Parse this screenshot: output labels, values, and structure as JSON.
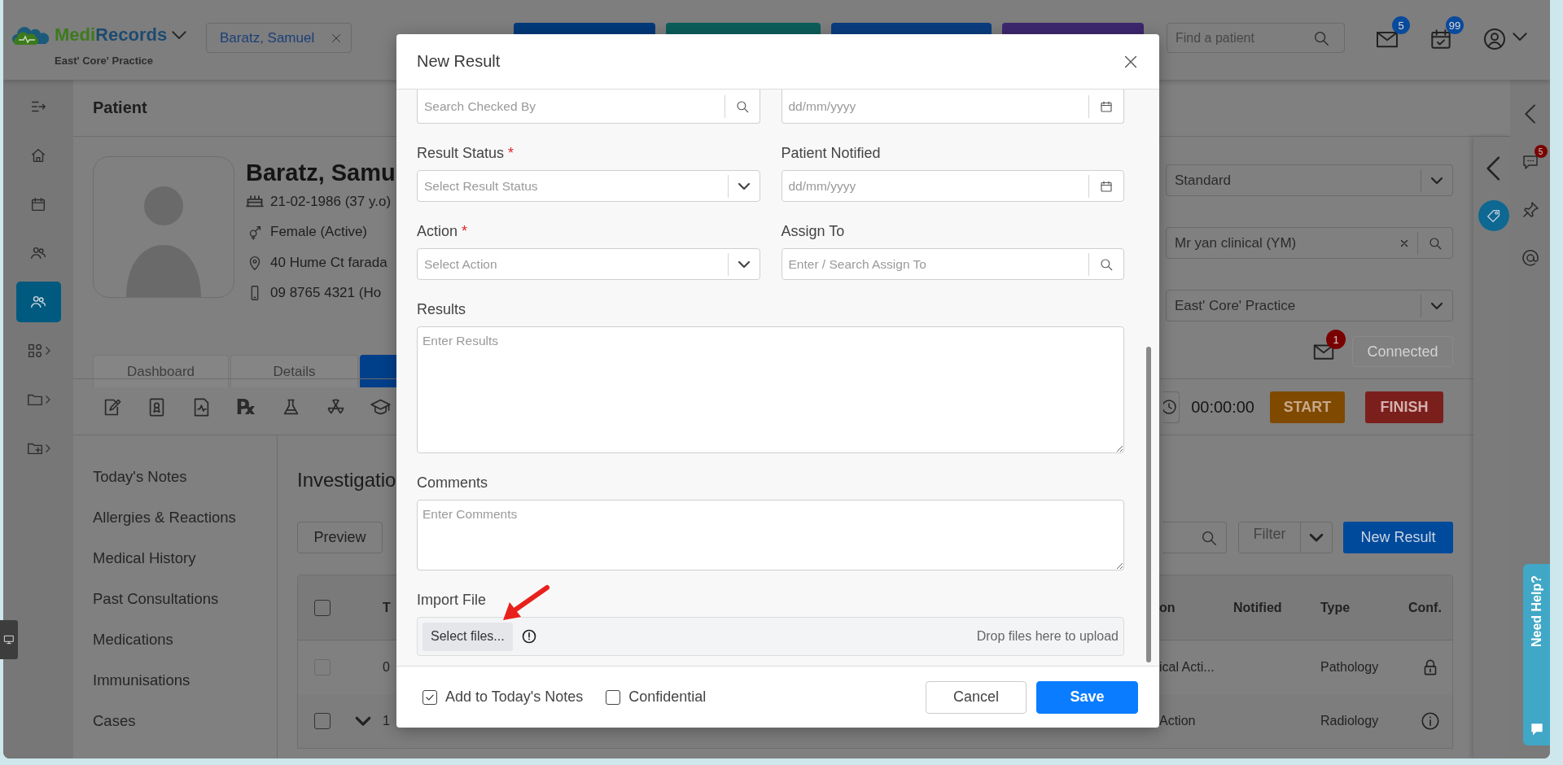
{
  "header": {
    "brand": "MediRecords",
    "practice": "East' Core' Practice",
    "patient_chip": "Baratz, Samuel",
    "quick_buttons": [
      {
        "color": "#00397a"
      },
      {
        "color": "#0b5e5b"
      },
      {
        "color": "#0a3d7f"
      },
      {
        "color": "#3d276e"
      }
    ],
    "search": {
      "placeholder": "Find a patient"
    },
    "notifications": [
      {
        "kind": "mail",
        "count": "5"
      },
      {
        "kind": "tasks",
        "count": "99"
      }
    ]
  },
  "rail": [
    {
      "selected": false,
      "submenu": false
    },
    {
      "selected": false,
      "submenu": false
    },
    {
      "selected": false,
      "submenu": false
    },
    {
      "selected": false,
      "submenu": false
    },
    {
      "selected": true,
      "submenu": false
    },
    {
      "selected": false,
      "submenu": true
    },
    {
      "selected": false,
      "submenu": true
    },
    {
      "selected": false,
      "submenu": true
    }
  ],
  "page_title": "Patient",
  "patient": {
    "name": "Baratz, Samu",
    "details": [
      {
        "kind": "birth",
        "text": "21-02-1986 (37 y.o)"
      },
      {
        "kind": "gender",
        "text": "Female (Active)"
      },
      {
        "kind": "address",
        "text": "40 Hume Ct farada"
      },
      {
        "kind": "phone",
        "text": "09 8765 4321 (Ho"
      }
    ]
  },
  "patient_settings": [
    {
      "kind": "select",
      "value": "Standard"
    },
    {
      "kind": "search",
      "value": "Mr yan clinical (YM)"
    },
    {
      "kind": "select",
      "value": "East' Core' Practice"
    }
  ],
  "messages": {
    "count": "1"
  },
  "connection": {
    "label": "Connected",
    "disabled": true
  },
  "tabs": [
    {
      "label": "Dashboard",
      "selected": false
    },
    {
      "label": "Details",
      "selected": false
    },
    {
      "selected": true
    }
  ],
  "tools": [
    {
      "kind": "edit"
    },
    {
      "kind": "certificate"
    },
    {
      "kind": "report"
    },
    {
      "kind": "rx",
      "symbol": "℞"
    },
    {
      "kind": "lab"
    },
    {
      "kind": "radiation"
    },
    {
      "kind": "education"
    }
  ],
  "timer": {
    "value": "00:00:00",
    "start": "START",
    "finish": "FINISH"
  },
  "sections": [
    "Today's Notes",
    "Allergies & Reactions",
    "Medical History",
    "Past Consultations",
    "Medications",
    "Immunisations",
    "Cases"
  ],
  "investigations": {
    "title": "Investigatio",
    "preview": "Preview",
    "filter": "Filter",
    "new_result": "New Result",
    "table": {
      "all_checked": false,
      "columns": [
        {
          "label": "T"
        },
        {
          "label": "on"
        },
        {
          "label": "Notified"
        },
        {
          "label": "Type"
        },
        {
          "label": "Conf."
        }
      ],
      "rows": [
        {
          "checked": false,
          "disabled": true,
          "expandable": false,
          "column_3": "0",
          "column_4": "ical Acti...",
          "type": "Pathology",
          "confidential": true
        },
        {
          "checked": false,
          "disabled": false,
          "expandable": true,
          "column_3": "1",
          "column_4": "Action",
          "type": "Radiology",
          "confidential": false
        }
      ]
    }
  },
  "side_panel": {
    "chat_count": "5"
  },
  "help": {
    "label": "Need Help?"
  },
  "modal": {
    "title": "New Result",
    "partial_fields": [
      {
        "kind": "search",
        "placeholder": "Search Checked By"
      },
      {
        "kind": "date",
        "placeholder": "dd/mm/yyyy"
      }
    ],
    "fields": [
      {
        "label": "Result Status",
        "required_mark": "*",
        "kind": "select",
        "placeholder": "Select Result Status"
      },
      {
        "label": "Patient Notified",
        "kind": "date",
        "placeholder": "dd/mm/yyyy"
      },
      {
        "label": "Action",
        "required_mark": "*",
        "kind": "select",
        "placeholder": "Select Action"
      },
      {
        "label": "Assign To",
        "kind": "search",
        "placeholder": "Enter / Search Assign To"
      }
    ],
    "results": {
      "label": "Results",
      "placeholder": "Enter Results"
    },
    "comments": {
      "label": "Comments",
      "placeholder": "Enter Comments"
    },
    "import": {
      "label": "Import File",
      "button": "Select files...",
      "hint": "Drop files here to upload"
    },
    "options": [
      {
        "label": "Add to Today's Notes",
        "checked": true
      },
      {
        "label": "Confidential",
        "checked": false
      }
    ],
    "buttons": [
      {
        "label": "Cancel",
        "kind": "secondary"
      },
      {
        "label": "Save",
        "kind": "primary"
      }
    ]
  }
}
